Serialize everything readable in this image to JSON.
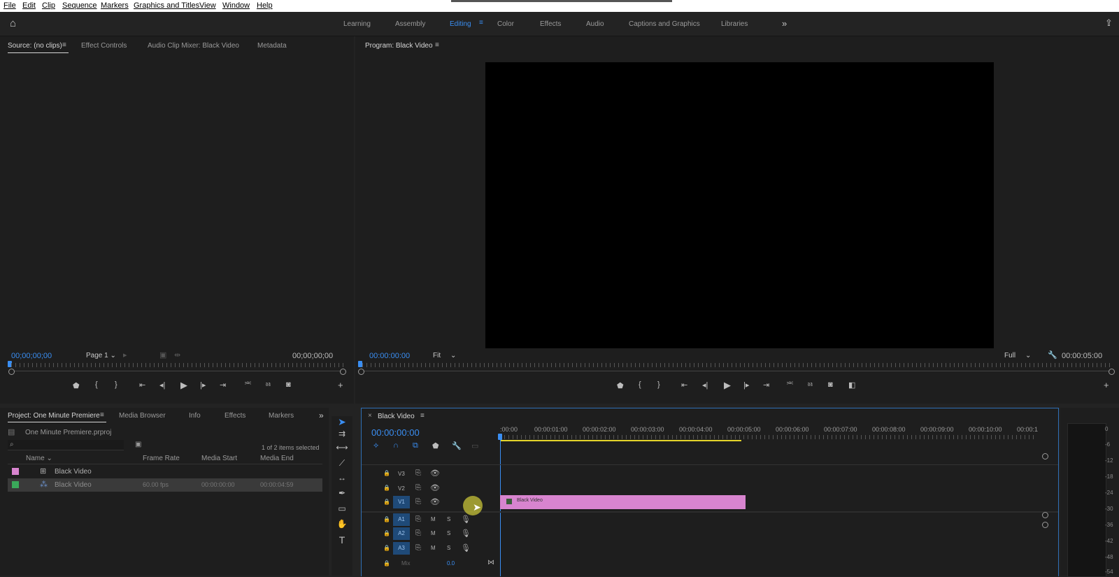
{
  "menu": [
    "File",
    "Edit",
    "Clip",
    "Sequence",
    "Markers",
    "Graphics and Titles",
    "View",
    "Window",
    "Help"
  ],
  "workspaces": {
    "items": [
      "Learning",
      "Assembly",
      "Editing",
      "Color",
      "Effects",
      "Audio",
      "Captions and Graphics",
      "Libraries"
    ],
    "active": "Editing",
    "more": "»"
  },
  "source_panel": {
    "tabs": [
      "Source: (no clips)",
      "Effect Controls",
      "Audio Clip Mixer: Black Video",
      "Metadata"
    ],
    "timecode_in": "00;00;00;00",
    "page": "Page 1",
    "timecode_out": "00;00;00;00"
  },
  "program_panel": {
    "title": "Program: Black Video",
    "timecode": "00:00:00:00",
    "fit": "Fit",
    "quality": "Full",
    "duration": "00:00:05:00"
  },
  "project_panel": {
    "tabs": [
      "Project: One Minute Premiere",
      "Media Browser",
      "Info",
      "Effects",
      "Markers"
    ],
    "file": "One Minute Premiere.prproj",
    "selection": "1 of 2 items selected",
    "columns": [
      "Name",
      "Frame Rate",
      "Media Start",
      "Media End"
    ],
    "rows": [
      {
        "name": "Black Video",
        "frame_rate": "",
        "media_start": "",
        "media_end": "",
        "color": "#d884cf"
      },
      {
        "name": "Black Video",
        "frame_rate": "60.00 fps",
        "media_start": "00:00:00:00",
        "media_end": "00:00:04:59",
        "color": "#3aa85a"
      }
    ]
  },
  "timeline": {
    "tab": "Black Video",
    "timecode": "00:00:00:00",
    "ruler": [
      ":00:00",
      "00:00:01:00",
      "00:00:02:00",
      "00:00:03:00",
      "00:00:04:00",
      "00:00:05:00",
      "00:00:06:00",
      "00:00:07:00",
      "00:00:08:00",
      "00:00:09:00",
      "00:00:10:00",
      "00:00:1"
    ],
    "video_tracks": [
      "V3",
      "V2",
      "V1"
    ],
    "audio_tracks": [
      "A1",
      "A2",
      "A3"
    ],
    "mute": "M",
    "solo": "S",
    "mix_label": "Mix",
    "mix_value": "0.0",
    "clip_name": "Black Video",
    "clip_color": "#d884cf"
  },
  "meter": {
    "labels": [
      "0",
      "-6",
      "-12",
      "-18",
      "-24",
      "-30",
      "-36",
      "-42",
      "-48",
      "-54"
    ]
  },
  "colors": {
    "accent": "#3a8ef2",
    "clip": "#d884cf",
    "work_area": "#e5d52a"
  }
}
